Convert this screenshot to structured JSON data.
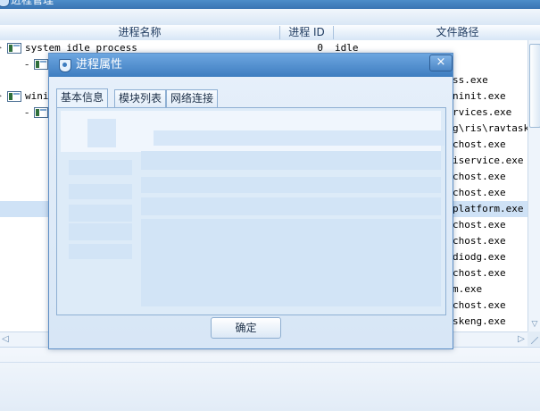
{
  "window": {
    "title": "进程管理"
  },
  "columns": {
    "name": "进程名称",
    "pid": "进程 ID",
    "path": "文件路径"
  },
  "rows": [
    {
      "name": "system idle process",
      "pid": "0",
      "path": "idle"
    },
    {
      "name": "",
      "pid": "",
      "path": ""
    },
    {
      "name": "",
      "pid": "",
      "path": "ss.exe"
    },
    {
      "name": "winin",
      "pid": "",
      "path": "ninit.exe"
    },
    {
      "name": "",
      "pid": "",
      "path": "rvices.exe"
    },
    {
      "name": "",
      "pid": "",
      "path": "g\\ris\\ravtask."
    },
    {
      "name": "",
      "pid": "",
      "path": "chost.exe"
    },
    {
      "name": "",
      "pid": "",
      "path": "iservice.exe"
    },
    {
      "name": "",
      "pid": "",
      "path": "chost.exe"
    },
    {
      "name": "",
      "pid": "",
      "path": "chost.exe"
    },
    {
      "name": "",
      "pid": "",
      "path": "platform.exe"
    },
    {
      "name": "",
      "pid": "",
      "path": "chost.exe"
    },
    {
      "name": "",
      "pid": "",
      "path": "chost.exe"
    },
    {
      "name": "",
      "pid": "",
      "path": "diodg.exe"
    },
    {
      "name": "",
      "pid": "",
      "path": "chost.exe"
    },
    {
      "name": "",
      "pid": "",
      "path": "m.exe"
    },
    {
      "name": "",
      "pid": "",
      "path": "chost.exe"
    },
    {
      "name": "",
      "pid": "",
      "path": "skeng.exe"
    }
  ],
  "selected_row_index": 10,
  "dialog": {
    "title": "进程属性",
    "close_glyph": "×",
    "tabs": [
      "基本信息",
      "模块列表",
      "网络连接"
    ],
    "active_tab": 0,
    "ok_label": "确定"
  },
  "icons": {
    "window": "app-icon",
    "dialog": "shield-icon",
    "process": "process-icon",
    "close": "close-icon"
  },
  "colors": {
    "title_bar": "#4a89cb",
    "selection": "#cfe2f6",
    "placeholder": "#d2e4f6"
  }
}
